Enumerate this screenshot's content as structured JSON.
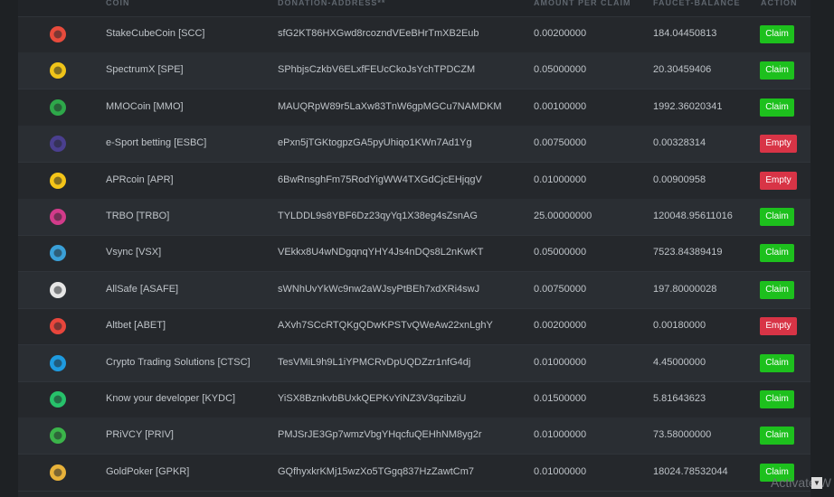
{
  "headers": {
    "coin": "COIN",
    "address": "DONATION-ADDRESS**",
    "amount": "AMOUNT PER CLAIM",
    "balance": "FAUCET-BALANCE",
    "action": "ACTION"
  },
  "rows": [
    {
      "coin": "StakeCubeCoin [SCC]",
      "address": "sfG2KT86HXGwd8rcozndVEeBHrTmXB2Eub",
      "amount": "0.00200000",
      "balance": "184.04450813",
      "action": "Claim",
      "logo_icon": "stakecube-logo-icon",
      "color": "#e84b3c"
    },
    {
      "coin": "SpectrumX [SPE]",
      "address": "SPhbjsCzkbV6ELxfFEUcCkoJsYchTPDCZM",
      "amount": "0.05000000",
      "balance": "20.30459406",
      "action": "Claim",
      "logo_icon": "spectrumx-logo-icon",
      "color": "#f0c419"
    },
    {
      "coin": "MMOCoin [MMO]",
      "address": "MAUQRpW89r5LaXw83TnW6gpMGCu7NAMDKM",
      "amount": "0.00100000",
      "balance": "1992.36020341",
      "action": "Claim",
      "logo_icon": "mmocoin-logo-icon",
      "color": "#2ea84a"
    },
    {
      "coin": "e-Sport betting [ESBC]",
      "address": "ePxn5jTGKtogpzGA5pyUhiqo1KWn7Ad1Yg",
      "amount": "0.00750000",
      "balance": "0.00328314",
      "action": "Empty",
      "logo_icon": "esbc-logo-icon",
      "color": "#4a3f8f"
    },
    {
      "coin": "APRcoin [APR]",
      "address": "6BwRnsghFm75RodYigWW4TXGdCjcEHjqgV",
      "amount": "0.01000000",
      "balance": "0.00900958",
      "action": "Empty",
      "logo_icon": "aprcoin-logo-icon",
      "color": "#f5c518"
    },
    {
      "coin": "TRBO [TRBO]",
      "address": "TYLDDL9s8YBF6Dz23qyYq1X38eg4sZsnAG",
      "amount": "25.00000000",
      "balance": "120048.95611016",
      "action": "Claim",
      "logo_icon": "trbo-logo-icon",
      "color": "#d23b8a"
    },
    {
      "coin": "Vsync [VSX]",
      "address": "VEkkx8U4wNDgqnqYHY4Js4nDQs8L2nKwKT",
      "amount": "0.05000000",
      "balance": "7523.84389419",
      "action": "Claim",
      "logo_icon": "vsync-logo-icon",
      "color": "#3aa0d8"
    },
    {
      "coin": "AllSafe [ASAFE]",
      "address": "sWNhUvYkWc9nw2aWJsyPtBEh7xdXRi4swJ",
      "amount": "0.00750000",
      "balance": "197.80000028",
      "action": "Claim",
      "logo_icon": "allsafe-logo-icon",
      "color": "#e6e6e6"
    },
    {
      "coin": "Altbet [ABET]",
      "address": "AXvh7SCcRTQKgQDwKPSTvQWeAw22xnLghY",
      "amount": "0.00200000",
      "balance": "0.00180000",
      "action": "Empty",
      "logo_icon": "altbet-logo-icon",
      "color": "#e8463c"
    },
    {
      "coin": "Crypto Trading Solutions [CTSC]",
      "address": "TesVMiL9h9L1iYPMCRvDpUQDZzr1nfG4dj",
      "amount": "0.01000000",
      "balance": "4.45000000",
      "action": "Claim",
      "logo_icon": "ctsc-logo-icon",
      "color": "#1e9be0"
    },
    {
      "coin": "Know your developer [KYDC]",
      "address": "YiSX8BznkvbBUxkQEPKvYiNZ3V3qzibziU",
      "amount": "0.01500000",
      "balance": "5.81643623",
      "action": "Claim",
      "logo_icon": "kydc-logo-icon",
      "color": "#27c26b"
    },
    {
      "coin": "PRiVCY [PRIV]",
      "address": "PMJSrJE3Gp7wmzVbgYHqcfuQEHhNM8yg2r",
      "amount": "0.01000000",
      "balance": "73.58000000",
      "action": "Claim",
      "logo_icon": "privcy-logo-icon",
      "color": "#3bb44a"
    },
    {
      "coin": "GoldPoker [GPKR]",
      "address": "GQfhyxkrKMj15wzXo5TGgq837HzZawtCm7",
      "amount": "0.01000000",
      "balance": "18024.78532044",
      "action": "Claim",
      "logo_icon": "goldpoker-logo-icon",
      "color": "#e8b23a"
    }
  ],
  "colors": {
    "claim": "#1dc01d",
    "empty": "#d83446",
    "background": "#25282c"
  },
  "overlay": {
    "activate_text": "Activate W"
  }
}
